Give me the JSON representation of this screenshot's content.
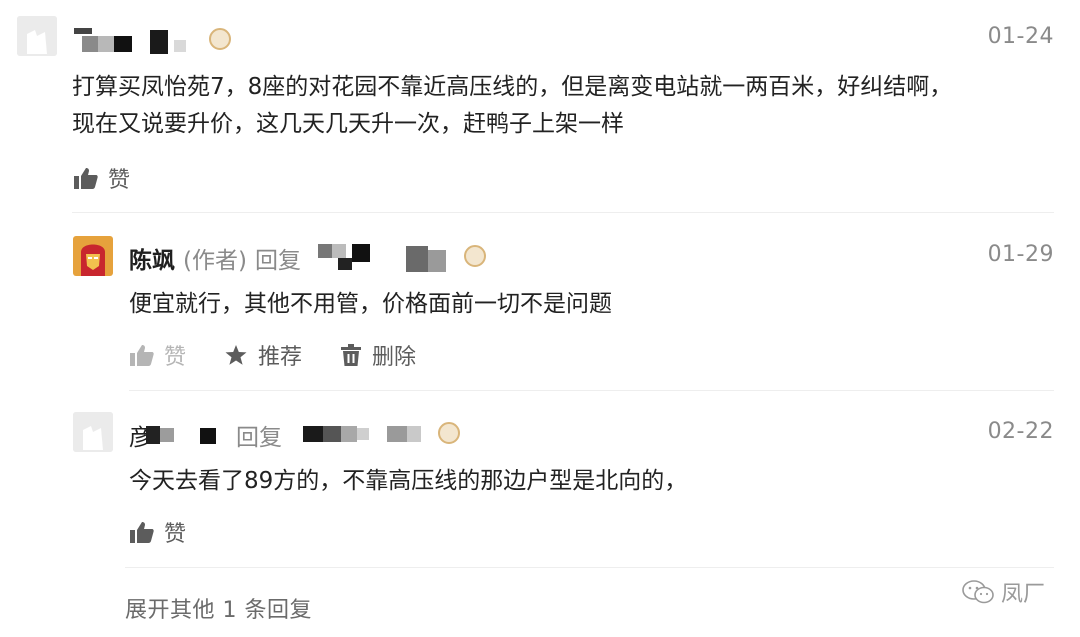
{
  "comment1": {
    "date": "01-24",
    "content_line1": "打算买凤怡苑7，8座的对花园不靠近高压线的，但是离变电站就一两百米，好纠结啊，",
    "content_line2": "现在又说要升价，这几天几天升一次，赶鸭子上架一样",
    "like_label": "赞"
  },
  "reply1": {
    "author": "陈飒",
    "role": "(作者)",
    "reply_word": "回复",
    "date": "01-29",
    "content": "便宜就行，其他不用管，价格面前一切不是问题",
    "like_label": "赞",
    "recommend_label": "推荐",
    "delete_label": "删除"
  },
  "reply2": {
    "name_char": "彦",
    "reply_word": "回复",
    "date": "02-22",
    "content": "今天去看了89方的，不靠高压线的那边户型是北向的，",
    "like_label": "赞"
  },
  "expand_more": "展开其他 1 条回复",
  "watermark": "凤厂",
  "colors": {
    "muted": "#8a8a8a",
    "text": "#222222",
    "crown": "#d9b57a"
  },
  "icons": [
    "thumbs-up-icon",
    "star-icon",
    "trash-icon",
    "crown-badge-icon",
    "wechat-icon"
  ]
}
